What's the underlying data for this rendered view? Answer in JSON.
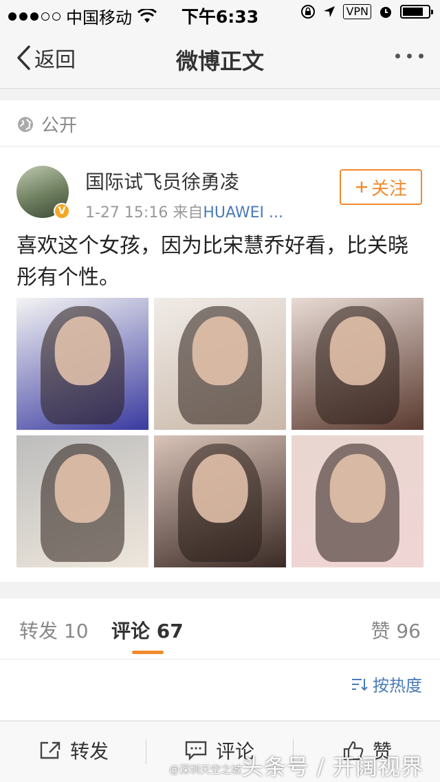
{
  "status_bar": {
    "carrier": "中国移动",
    "time": "下午6:33",
    "vpn": "VPN",
    "signal_filled": 3,
    "signal_total": 5,
    "battery_fraction": 0.8
  },
  "nav": {
    "back_label": "返回",
    "title": "微博正文"
  },
  "visibility": {
    "label": "公开"
  },
  "post": {
    "username": "国际试飞员徐勇凌",
    "timestamp": "1-27 15:16",
    "source_prefix": "来自",
    "source": "HUAWEI ...",
    "follow_label": "关注",
    "text": "喜欢这个女孩，因为比宋慧乔好看，比关晓彤有个性。",
    "images": [
      {
        "bg": "#f4f4f4",
        "accent": "#3a3aa0"
      },
      {
        "bg": "#f1ece8",
        "accent": "#c9b7a8"
      },
      {
        "bg": "#e8dbd4",
        "accent": "#5a3a30"
      },
      {
        "bg": "#bdbdbd",
        "accent": "#efe7dc"
      },
      {
        "bg": "#d9c3b8",
        "accent": "#3a2a25"
      },
      {
        "bg": "#e9d6d0",
        "accent": "#f0d5d5"
      }
    ]
  },
  "tabs": {
    "repost": "转发 10",
    "comment": "评论 67",
    "like": "赞 96"
  },
  "sort_label": "按热度",
  "bottom_bar": {
    "repost": "转发",
    "comment": "评论",
    "like": "赞"
  },
  "watermark": "头条号 / 开阔视界",
  "watermark_small": "@深圳天空之城"
}
